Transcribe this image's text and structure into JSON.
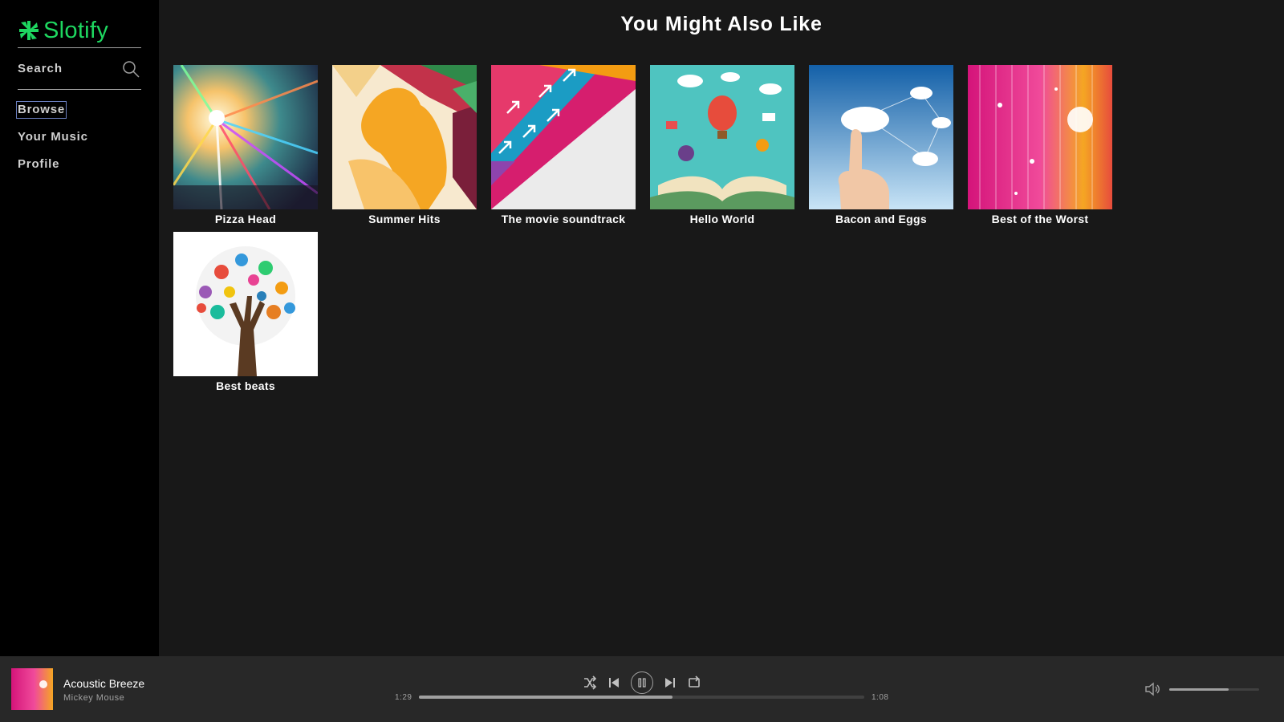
{
  "sidebar": {
    "logo_text": "Slotify",
    "search_label": "Search",
    "nav": [
      "Browse",
      "Your Music",
      "Profile"
    ],
    "active_nav": "Browse"
  },
  "main": {
    "title": "You Might Also Like",
    "albums": [
      {
        "title": "Pizza Head"
      },
      {
        "title": "Summer Hits"
      },
      {
        "title": "The movie soundtrack"
      },
      {
        "title": "Hello World"
      },
      {
        "title": "Bacon and Eggs"
      },
      {
        "title": "Best of the Worst"
      },
      {
        "title": "Best beats"
      }
    ]
  },
  "player": {
    "track_title": "Acoustic Breeze",
    "artist": "Mickey Mouse",
    "current_time": "1:29",
    "total_time": "1:08",
    "progress_fraction": 0.57,
    "volume_fraction": 0.66,
    "playing": true
  },
  "colors": {
    "accent": "#1ed760",
    "sidebar_bg": "#000000",
    "main_bg": "#181818",
    "player_bg": "#282828"
  },
  "icons": [
    "slotify-logo-icon",
    "search-icon",
    "shuffle-icon",
    "previous-icon",
    "pause-icon",
    "next-icon",
    "repeat-icon",
    "volume-icon"
  ]
}
